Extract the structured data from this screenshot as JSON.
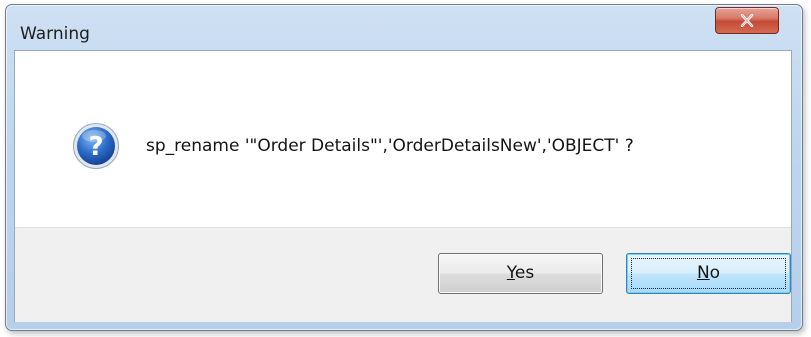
{
  "window": {
    "title": "Warning",
    "close_label": "X"
  },
  "dialog": {
    "icon": "question-icon",
    "message": "sp_rename '\"Order Details\"','OrderDetailsNew','OBJECT' ?"
  },
  "buttons": {
    "yes": {
      "mnemonic": "Y",
      "rest": "es"
    },
    "no": {
      "mnemonic": "N",
      "rest": "o"
    }
  },
  "colors": {
    "close_button": "#c44b35",
    "icon_blue": "#1f5fbf",
    "focused_button": "#bee6fd"
  }
}
